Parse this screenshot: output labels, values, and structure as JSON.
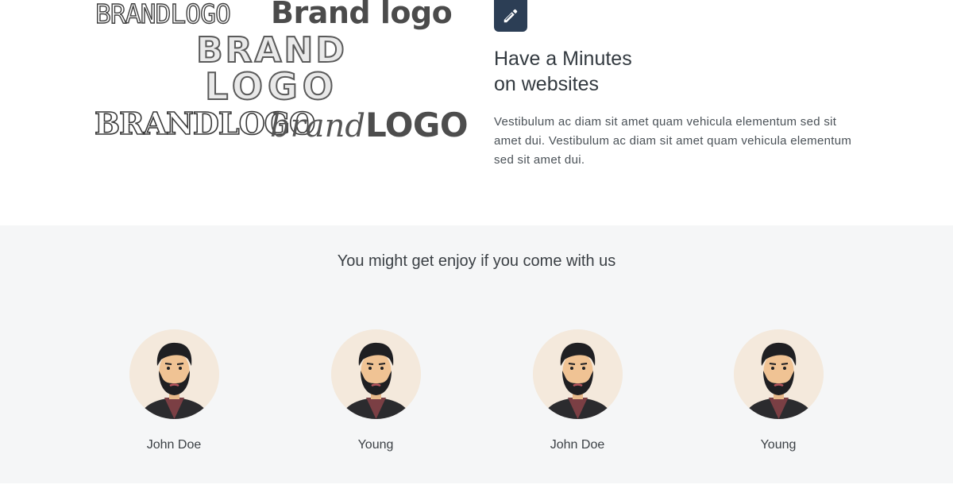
{
  "brand_logos": {
    "logo_1": "BRANDLOGO",
    "logo_2": "Brand logo",
    "logo_3": "BRAND",
    "logo_4": "LOGO",
    "logo_5": "BRANDLOGO",
    "logo_6_script": "brand",
    "logo_6_bold": "LOGO"
  },
  "feature": {
    "icon": "pencil-icon",
    "accent_color": "#2c3e55",
    "title_line1": "Have a Minutes",
    "title_line2": "on websites",
    "description": "Vestibulum ac diam sit amet quam vehicula elementum sed sit amet dui. Vestibulum ac diam sit amet quam vehicula elementum sed sit amet dui."
  },
  "team": {
    "heading": "You might get enjoy if you come with us",
    "members": [
      {
        "name": "John Doe",
        "avatar": "bearded-man-avatar"
      },
      {
        "name": "Young",
        "avatar": "bearded-man-avatar"
      },
      {
        "name": "John Doe",
        "avatar": "bearded-man-avatar"
      },
      {
        "name": "Young",
        "avatar": "bearded-man-avatar"
      }
    ]
  },
  "colors": {
    "section_background": "#f5f6f7",
    "avatar_background": "#f4e9dc",
    "text": "#333a40"
  }
}
